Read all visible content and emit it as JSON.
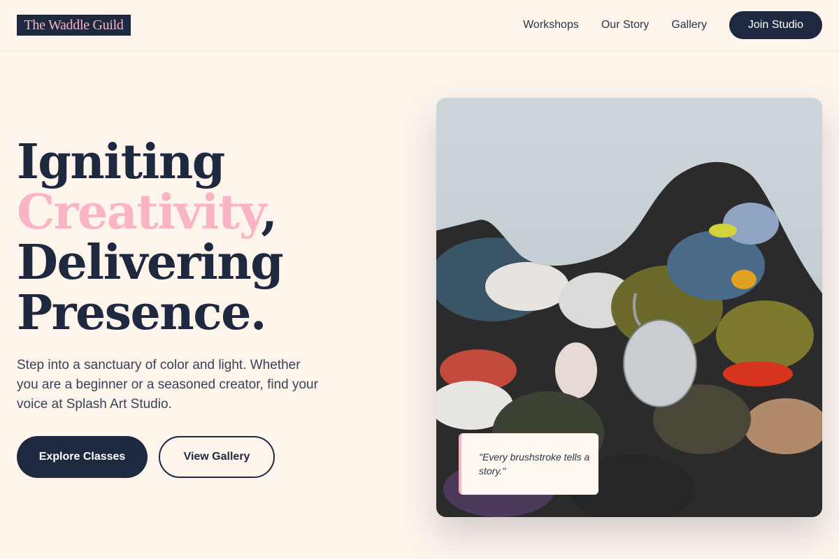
{
  "header": {
    "logo": "The Waddle Guild",
    "nav": [
      "Workshops",
      "Our Story",
      "Gallery"
    ],
    "cta": "Join Studio"
  },
  "hero": {
    "line1": "Igniting",
    "line2_accent": "Creativity",
    "line2_punct": ",",
    "line3": "Delivering",
    "line4": "Presence.",
    "description": "Step into a sanctuary of color and light. Whether you are a beginner or a seasoned creator, find your voice at Splash Art Studio.",
    "primary_button": "Explore Classes",
    "secondary_button": "View Gallery"
  },
  "image": {
    "quote": "\"Every brushstroke tells a story.\""
  },
  "colors": {
    "navy": "#1e2940",
    "pink": "#f9b5c3",
    "background": "#fdf4ec"
  }
}
